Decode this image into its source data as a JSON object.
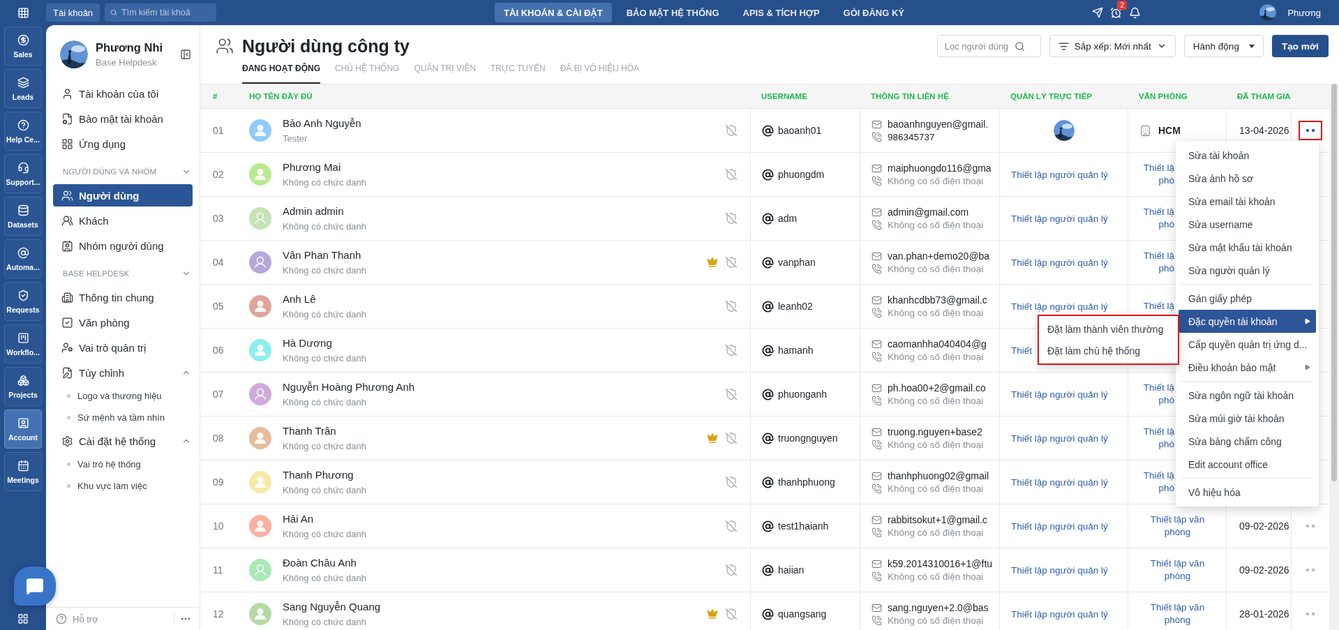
{
  "topbar": {
    "workspace_button": "Tài khoản",
    "search_placeholder": "Tìm kiếm tài khoả",
    "nav": [
      {
        "label": "TÀI KHOẢN & CÀI ĐẶT",
        "selected": true
      },
      {
        "label": "BẢO MẬT HỆ THỐNG",
        "selected": false
      },
      {
        "label": "APIS & TÍCH HỢP",
        "selected": false
      },
      {
        "label": "GÓI ĐĂNG KÝ",
        "selected": false
      }
    ],
    "alarm_badge": "2",
    "user_name": "Phương"
  },
  "rail": {
    "apps": [
      {
        "label": "Sales",
        "selected": false
      },
      {
        "label": "Leads",
        "selected": false
      },
      {
        "label": "Help Ce...",
        "selected": false
      },
      {
        "label": "Support...",
        "selected": false
      },
      {
        "label": "Datasets",
        "selected": false
      },
      {
        "label": "Automa...",
        "selected": false
      },
      {
        "label": "Requests",
        "selected": false
      },
      {
        "label": "Workflo...",
        "selected": false
      },
      {
        "label": "Projects",
        "selected": false
      },
      {
        "label": "Account",
        "selected": true
      },
      {
        "label": "Meetings",
        "selected": false
      }
    ]
  },
  "sidebar": {
    "profile": {
      "name": "Phương Nhi",
      "subtitle": "Base Helpdesk"
    },
    "sections": [
      {
        "items": [
          {
            "label": "Tài khoản của tôi",
            "selected": false
          },
          {
            "label": "Bảo mật tài khoản",
            "selected": false
          },
          {
            "label": "Ứng dụng",
            "selected": false
          }
        ]
      },
      {
        "title": "NGƯỜI DÙNG VÀ NHÓM",
        "expanded": true,
        "items": [
          {
            "label": "Người dùng",
            "selected": true
          },
          {
            "label": "Khách",
            "selected": false
          },
          {
            "label": "Nhóm người dùng",
            "selected": false
          }
        ]
      },
      {
        "title": "BASE HELPDESK",
        "expanded": true,
        "items": [
          {
            "label": "Thông tin chung",
            "selected": false
          },
          {
            "label": "Văn phòng",
            "selected": false
          },
          {
            "label": "Vai trò quản trị",
            "selected": false
          },
          {
            "label": "Tùy chỉnh",
            "selected": false,
            "expanded": true,
            "children": [
              {
                "label": "Logo và thương hiệu",
                "selected": false
              },
              {
                "label": "Sứ mệnh và tầm nhìn",
                "selected": false
              }
            ]
          },
          {
            "label": "Cài đặt hệ thống",
            "selected": false,
            "expanded": true,
            "children": [
              {
                "label": "Vai trò hệ thống",
                "selected": false
              },
              {
                "label": "Khu vực làm việc",
                "selected": false
              }
            ]
          }
        ]
      }
    ],
    "footer": {
      "help": "Hỗ trợ"
    }
  },
  "main": {
    "title": "Người dùng công ty",
    "tabs": [
      {
        "label": "ĐANG HOẠT ĐỘNG",
        "selected": true
      },
      {
        "label": "CHỦ HỆ THỐNG",
        "selected": false
      },
      {
        "label": "QUẢN TRỊ VIÊN",
        "selected": false
      },
      {
        "label": "TRỰC TUYẾN",
        "selected": false
      },
      {
        "label": "ĐÃ BỊ VÔ HIỆU HÓA",
        "selected": false
      }
    ],
    "filter_placeholder": "Lọc người dùng",
    "sort_label": "Sắp xếp: Mới nhất",
    "actions_label": "Hành động",
    "create_label": "Tạo mới"
  },
  "table": {
    "columns": [
      "#",
      "HỌ TÊN ĐẦY ĐỦ",
      "USERNAME",
      "THÔNG TIN LIÊN HỆ",
      "QUẢN LÝ TRỰC TIẾP",
      "VĂN PHÒNG",
      "ĐÃ THAM GIA"
    ],
    "rows": [
      {
        "no": "01",
        "name": "Bảo Anh Nguyễn",
        "title": "Tester",
        "color": "#90caf9",
        "avatar_outline": false,
        "owner": false,
        "username": "baoanh01",
        "email": "baoanhnguyen@gmail.",
        "phone": "986345737",
        "phone_missing": false,
        "manager": {
          "kind": "avatar"
        },
        "office": {
          "kind": "place",
          "text": "HCM"
        },
        "joined": "13-04-2026",
        "actions": true,
        "menu_open": true
      },
      {
        "no": "02",
        "name": "Phương Mai",
        "title": "Không có chức danh",
        "color": "#b9ea8f",
        "avatar_outline": false,
        "owner": false,
        "username": "phuongdm",
        "email": "maiphuongdo116@gma",
        "phone": "Không có số điện thoại",
        "phone_missing": true,
        "manager": {
          "kind": "link",
          "text": "Thiết lập người quản lý"
        },
        "office": {
          "kind": "cut",
          "lines": [
            "Thiết lậ",
            "phò"
          ]
        },
        "actions": false
      },
      {
        "no": "03",
        "name": "Admin admin",
        "title": "Không có chức danh",
        "color": "#c5e3b5",
        "avatar_outline": true,
        "owner": false,
        "username": "adm",
        "email": "admin@gmail.com",
        "phone": "Không có số điện thoại",
        "phone_missing": true,
        "manager": {
          "kind": "link",
          "text": "Thiết lập người quản lý"
        },
        "office": {
          "kind": "cut",
          "lines": [
            "Thiết lậ",
            "phò"
          ]
        },
        "actions": false
      },
      {
        "no": "04",
        "name": "Vân Phan Thanh",
        "title": "Không có chức danh",
        "color": "#b6a8dd",
        "avatar_outline": true,
        "owner": true,
        "username": "vanphan",
        "email": "van.phan+demo20@ba",
        "phone": "Không có số điện thoại",
        "phone_missing": true,
        "manager": {
          "kind": "link",
          "text": "Thiết lập người quản lý"
        },
        "office": {
          "kind": "cut",
          "lines": [
            "Thiết lậ",
            "phò"
          ]
        },
        "actions": false
      },
      {
        "no": "05",
        "name": "Anh Lê",
        "title": "Không có chức danh",
        "color": "#e0a49c",
        "avatar_outline": false,
        "owner": false,
        "username": "leanh02",
        "email": "khanhcdbb73@gmail.c",
        "phone": "Không có số điện thoại",
        "phone_missing": true,
        "manager": {
          "kind": "link",
          "text": "Thiết lập người quản lý"
        },
        "office": {
          "kind": "cut",
          "lines": [
            "Thiết lậ"
          ]
        },
        "actions": false
      },
      {
        "no": "06",
        "name": "Hà Dương",
        "title": "Không có chức danh",
        "color": "#8deeee",
        "avatar_outline": false,
        "owner": false,
        "username": "hamanh",
        "email": "caomanhha040404@g",
        "phone": "Không có số điện thoại",
        "phone_missing": true,
        "manager": {
          "kind": "link",
          "text": "Thiết"
        },
        "actions": false
      },
      {
        "no": "07",
        "name": "Nguyễn Hoàng Phương Anh",
        "title": "Không có chức danh",
        "color": "#d0aadd",
        "avatar_outline": true,
        "owner": false,
        "username": "phuonganh",
        "email": "ph.hoa00+2@gmail.co",
        "phone": "Không có số điện thoại",
        "phone_missing": true,
        "manager": {
          "kind": "link",
          "text": "Thiết lập người quản lý"
        },
        "office": {
          "kind": "cut",
          "lines": [
            "Thiết lậ",
            "phò"
          ]
        },
        "actions": false
      },
      {
        "no": "08",
        "name": "Thanh Trân",
        "title": "Không có chức danh",
        "color": "#e3bd9d",
        "avatar_outline": false,
        "owner": true,
        "username": "truongnguyen",
        "email": "truong.nguyen+base2",
        "phone": "Không có số điện thoại",
        "phone_missing": true,
        "manager": {
          "kind": "link",
          "text": "Thiết lập người quản lý"
        },
        "office": {
          "kind": "cut",
          "lines": [
            "Thiết lậ",
            "phò"
          ]
        },
        "actions": false
      },
      {
        "no": "09",
        "name": "Thanh Phương",
        "title": "Không có chức danh",
        "color": "#f6eaa4",
        "avatar_outline": false,
        "owner": false,
        "username": "thanhphuong",
        "email": "thanhphuong02@gmail",
        "phone": "Không có số điện thoại",
        "phone_missing": true,
        "manager": {
          "kind": "link",
          "text": "Thiết lập người quản lý"
        },
        "office": {
          "kind": "cut",
          "lines": [
            "Thiết lậ",
            "phò"
          ]
        },
        "actions": false
      },
      {
        "no": "10",
        "name": "Hải An",
        "title": "Không có chức danh",
        "color": "#fcb09f",
        "avatar_outline": false,
        "owner": false,
        "username": "test1haianh",
        "email": "rabbitsokut+1@gmail.c",
        "phone": "Không có số điện thoại",
        "phone_missing": true,
        "manager": {
          "kind": "link",
          "text": "Thiết lập người quản lý"
        },
        "office": {
          "kind": "link",
          "text": "Thiết lập văn phòng"
        },
        "joined": "09-02-2026",
        "actions": true,
        "menu_open": false
      },
      {
        "no": "11",
        "name": "Đoàn Châu Anh",
        "title": "Không có chức danh",
        "color": "#a9e9b6",
        "avatar_outline": true,
        "owner": false,
        "username": "haiian",
        "email": "k59.2014310016+1@ftu",
        "phone": "Không có số điện thoại",
        "phone_missing": true,
        "manager": {
          "kind": "link",
          "text": "Thiết lập người quản lý"
        },
        "office": {
          "kind": "link",
          "text": "Thiết lập văn phòng"
        },
        "joined": "09-02-2026",
        "actions": true,
        "menu_open": false
      },
      {
        "no": "12",
        "name": "Sang Nguyễn Quang",
        "title": "Không có chức danh",
        "color": "#b6daa5",
        "avatar_outline": false,
        "owner": true,
        "username": "quangsang",
        "email": "sang.nguyen+2.0@bas",
        "phone": "Không có số điện thoại",
        "phone_missing": true,
        "manager": {
          "kind": "link",
          "text": "Thiết lập người quản lý"
        },
        "office": {
          "kind": "link",
          "text": "Thiết lập văn phòng"
        },
        "joined": "28-01-2026",
        "actions": true,
        "menu_open": false
      }
    ]
  },
  "menu": {
    "groups": [
      [
        {
          "label": "Sửa tài khoản",
          "selected": false,
          "submenu": false
        },
        {
          "label": "Sửa ảnh hồ sơ",
          "selected": false,
          "submenu": false
        },
        {
          "label": "Sửa email tài khoản",
          "selected": false,
          "submenu": false
        },
        {
          "label": "Sửa username",
          "selected": false,
          "submenu": false
        },
        {
          "label": "Sửa mật khẩu tài khoản",
          "selected": false,
          "submenu": false
        },
        {
          "label": "Sửa người quản lý",
          "selected": false,
          "submenu": false
        }
      ],
      [
        {
          "label": "Gán giấy phép",
          "selected": false,
          "submenu": false
        },
        {
          "label": "Đặc quyền tài khoản",
          "selected": true,
          "submenu": true
        },
        {
          "label": "Cấp quyền quản trị ứng d...",
          "selected": false,
          "submenu": false
        },
        {
          "label": "Điều khoản bảo mật",
          "selected": false,
          "submenu": true
        }
      ],
      [
        {
          "label": "Sửa ngôn ngữ tài khoản",
          "selected": false,
          "submenu": false
        },
        {
          "label": "Sửa múi giờ tài khoản",
          "selected": false,
          "submenu": false
        },
        {
          "label": "Sửa bảng chấm công",
          "selected": false,
          "submenu": false
        },
        {
          "label": "Edit account office",
          "selected": false,
          "submenu": false
        }
      ],
      [
        {
          "label": "Vô hiệu hóa",
          "selected": false,
          "submenu": false
        }
      ]
    ],
    "submenu": [
      {
        "label": "Đặt làm thành viên thường"
      },
      {
        "label": "Đặt làm chủ hệ thống"
      }
    ]
  }
}
